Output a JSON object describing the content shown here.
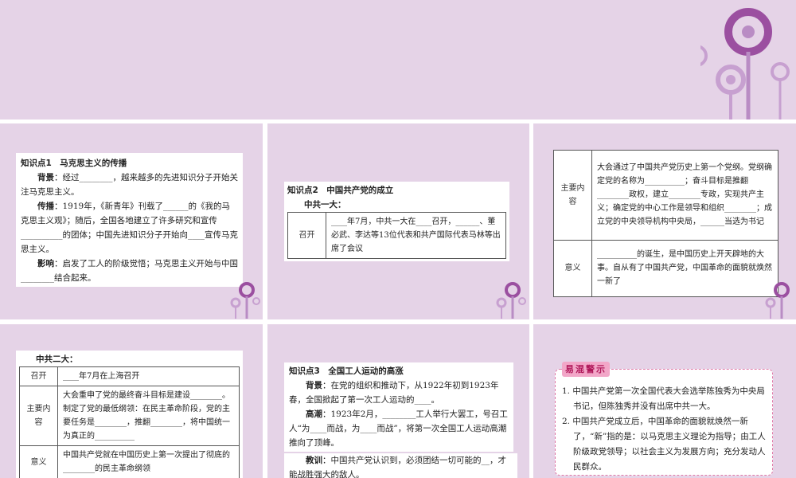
{
  "panel1": {
    "title": "知识点1　马克思主义的传播",
    "p1_label": "背景",
    "p1": "：经过________，越来越多的先进知识分子开始关注马克思主义。",
    "p2_label": "传播",
    "p2": "：1919年，《新青年》刊载了______的《我的马克思主义观》；随后，全国各地建立了许多研究和宣传__________的团体；中国先进知识分子开始向____宣传马克思主义。",
    "p3_label": "影响",
    "p3": "：启发了工人的阶级觉悟；马克思主义开始与中国________结合起来。"
  },
  "panel2": {
    "title": "知识点2　中国共产党的成立",
    "sub": "中共一大：",
    "row_label": "召开",
    "row_text": "____年7月，中共一大在____召开，______、董必武、李达等13位代表和共产国际代表马林等出席了会议"
  },
  "panel3": {
    "rows": [
      {
        "label": "主要内容",
        "text": "大会通过了中国共产党历史上第一个党纲。党纲确定党的名称为__________；奋斗目标是推翻________政权，建立________专政，实现共产主义；确定党的中心工作是领导和组织________；成立党的中央领导机构中央局，______当选为书记"
      },
      {
        "label": "意义",
        "text": "__________的诞生，是中国历史上开天辟地的大事。自从有了中国共产党，中国革命的面貌就焕然一新了"
      }
    ]
  },
  "panel4": {
    "sub": "中共二大：",
    "rows": [
      {
        "label": "召开",
        "text": "____年7月在上海召开"
      },
      {
        "label": "主要内容",
        "text": "大会重申了党的最终奋斗目标是建设________。制定了党的最低纲领：在民主革命阶段，党的主要任务是________，推翻________，将中国统一为真正的__________"
      },
      {
        "label": "意义",
        "text": "中国共产党就在中国历史上第一次提出了彻底的________的民主革命纲领"
      }
    ]
  },
  "panel5": {
    "title": "知识点3　全国工人运动的高涨",
    "p1_label": "背景",
    "p1": "：在党的组织和推动下，从1922年初到1923年春，全国掀起了第一次工人运动的____。",
    "p2_label": "高潮",
    "p2": "：1923年2月，________工人举行大罢工，号召工人“为____而战，为____而战”，将第一次全国工人运动高潮推向了顶峰。",
    "p3_label": "教训",
    "p3": "：中国共产党认识到，必须团结一切可能的__，才能战胜强大的敌人。"
  },
  "panel6": {
    "title": "易混警示",
    "items": [
      "1. 中国共产党第一次全国代表大会选举陈独秀为中央局书记，但陈独秀并没有出席中共一大。",
      "2. 中国共产党成立后，中国革命的面貌就焕然一新了，“新”指的是：以马克思主义理论为指导；由工人阶级政党领导；以社会主义为发展方向；充分发动人民群众。"
    ]
  },
  "colors": {
    "background": "#e5d3e7",
    "accent": "#9b4fa0",
    "pink": "#e07aa8"
  }
}
